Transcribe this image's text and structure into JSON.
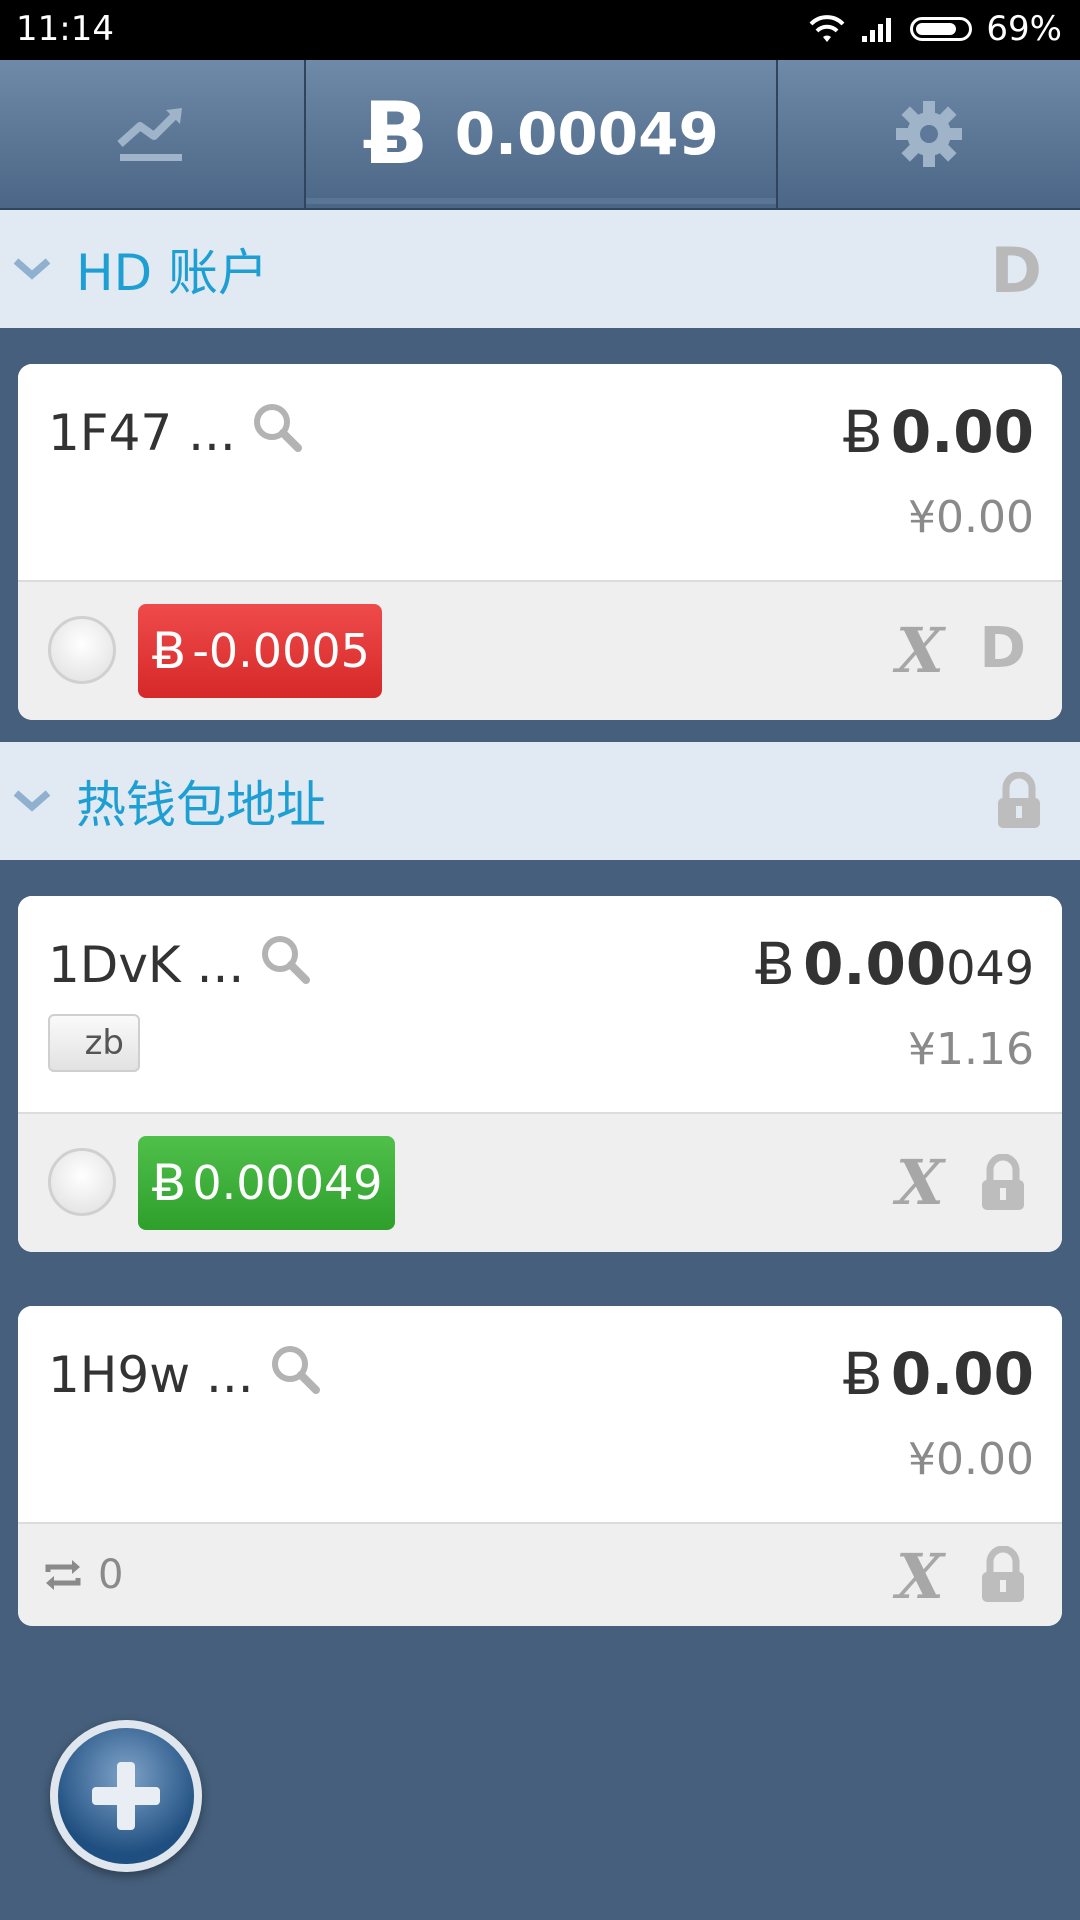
{
  "status_bar": {
    "time": "11:14",
    "battery": "69%"
  },
  "header": {
    "balance_symbol": "Ƀ",
    "balance": "0.00049"
  },
  "sections": [
    {
      "title": "HD 账户",
      "right_icon": "D"
    },
    {
      "title": "热钱包地址",
      "right_icon": "lock-icon"
    }
  ],
  "cards": [
    {
      "address": "1F47 ...",
      "btc_symbol": "Ƀ",
      "amount_main": "0.00",
      "amount_small": "",
      "fiat": "¥0.00",
      "pill": "-0.0005",
      "pill_symbol": "Ƀ",
      "right_icon": "D"
    },
    {
      "address": "1DvK ...",
      "tag": "zb",
      "btc_symbol": "Ƀ",
      "amount_main": "0.00",
      "amount_small": "049",
      "fiat": "¥1.16",
      "pill": "0.00049",
      "pill_symbol": "Ƀ",
      "right_icon": "lock-icon"
    },
    {
      "address": "1H9w ...",
      "btc_symbol": "Ƀ",
      "amount_main": "0.00",
      "amount_small": "",
      "fiat": "¥0.00",
      "tx_count": "0",
      "right_icon": "lock-icon"
    }
  ],
  "colors": {
    "accent": "#1e9fd4",
    "red_pill": "#d62828",
    "green_pill": "#2f9f2c",
    "background": "#455f7c"
  }
}
